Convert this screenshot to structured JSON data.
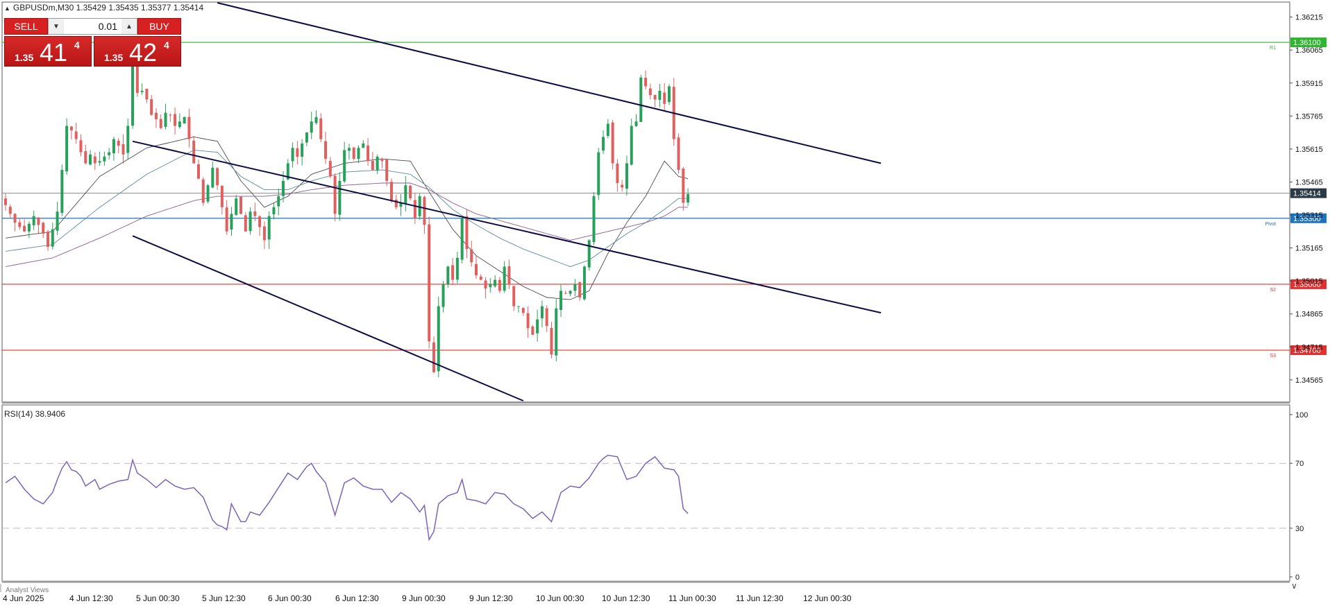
{
  "symbol_info": "GBPUSDm,M30  1.35429 1.35435 1.35377 1.35414",
  "trade_panel": {
    "sell_label": "SELL",
    "buy_label": "BUY",
    "lot_value": "0.01",
    "sell_price_small": "1.35",
    "sell_price_big": "41",
    "sell_price_sup": "4",
    "buy_price_small": "1.35",
    "buy_price_big": "42",
    "buy_price_sup": "4"
  },
  "chart_data": [
    {
      "type": "candlestick",
      "symbol": "GBPUSDm",
      "timeframe": "M30",
      "ohlc_current": {
        "open": 1.35429,
        "high": 1.35435,
        "low": 1.35377,
        "close": 1.35414
      },
      "current_price": 1.35414,
      "ylim": [
        1.3447,
        1.3628
      ],
      "y_ticks": [
        "1.36215",
        "1.36065",
        "1.35915",
        "1.35765",
        "1.35615",
        "1.35465",
        "1.35315",
        "1.35165",
        "1.35015",
        "1.34865",
        "1.34715",
        "1.34565"
      ],
      "x_ticks": [
        "4 Jun 2025",
        "4 Jun 12:30",
        "5 Jun 00:30",
        "5 Jun 12:30",
        "6 Jun 00:30",
        "6 Jun 12:30",
        "9 Jun 00:30",
        "9 Jun 12:30",
        "10 Jun 00:30",
        "10 Jun 12:30",
        "11 Jun 00:30",
        "11 Jun 12:30",
        "12 Jun 00:30"
      ],
      "horizontal_levels": [
        {
          "label": "R1",
          "price": 1.361,
          "price_label": "1.36100",
          "color": "#2fb52f"
        },
        {
          "label": "Pivot",
          "price": 1.353,
          "price_label": "1.35300",
          "color": "#1e73be"
        },
        {
          "label": "S2",
          "price": 1.35,
          "price_label": "1.35000",
          "color": "#e03030"
        },
        {
          "label": "S3",
          "price": 1.347,
          "price_label": "1.34700",
          "color": "#e03030"
        }
      ],
      "current_price_label": "1.35414",
      "close_path": [
        [
          0,
          1.3536
        ],
        [
          2,
          1.3528
        ],
        [
          4,
          1.3524
        ],
        [
          6,
          1.3531
        ],
        [
          8,
          1.3523
        ],
        [
          9,
          1.3517
        ],
        [
          11,
          1.3533
        ],
        [
          12,
          1.3552
        ],
        [
          13,
          1.3572
        ],
        [
          14,
          1.357
        ],
        [
          15,
          1.3566
        ],
        [
          16,
          1.356
        ],
        [
          17,
          1.3555
        ],
        [
          18,
          1.3559
        ],
        [
          19,
          1.3555
        ],
        [
          20,
          1.3556
        ],
        [
          21,
          1.3558
        ],
        [
          22,
          1.356
        ],
        [
          23,
          1.3566
        ],
        [
          24,
          1.3563
        ],
        [
          25,
          1.3559
        ],
        [
          26,
          1.3572
        ],
        [
          27,
          1.3605
        ],
        [
          28,
          1.3587
        ],
        [
          29,
          1.3588
        ],
        [
          30,
          1.3584
        ],
        [
          31,
          1.3577
        ],
        [
          32,
          1.3575
        ],
        [
          33,
          1.3571
        ],
        [
          34,
          1.3578
        ],
        [
          35,
          1.3577
        ],
        [
          36,
          1.3572
        ],
        [
          37,
          1.3574
        ],
        [
          38,
          1.3576
        ],
        [
          39,
          1.3566
        ],
        [
          40,
          1.3555
        ],
        [
          41,
          1.3548
        ],
        [
          42,
          1.3537
        ],
        [
          43,
          1.3545
        ],
        [
          44,
          1.3553
        ],
        [
          45,
          1.3545
        ],
        [
          46,
          1.3535
        ],
        [
          47,
          1.3524
        ],
        [
          48,
          1.3532
        ],
        [
          49,
          1.3539
        ],
        [
          50,
          1.3532
        ],
        [
          51,
          1.3524
        ],
        [
          52,
          1.3533
        ],
        [
          53,
          1.3531
        ],
        [
          54,
          1.3526
        ],
        [
          55,
          1.352
        ],
        [
          56,
          1.3531
        ],
        [
          57,
          1.3535
        ],
        [
          58,
          1.354
        ],
        [
          59,
          1.3547
        ],
        [
          60,
          1.3555
        ],
        [
          61,
          1.3562
        ],
        [
          62,
          1.3558
        ],
        [
          63,
          1.3564
        ],
        [
          64,
          1.3569
        ],
        [
          65,
          1.3574
        ],
        [
          66,
          1.3576
        ],
        [
          67,
          1.3566
        ],
        [
          68,
          1.3557
        ],
        [
          69,
          1.3549
        ],
        [
          70,
          1.3532
        ],
        [
          71,
          1.3547
        ],
        [
          72,
          1.3561
        ],
        [
          73,
          1.3562
        ],
        [
          74,
          1.3557
        ],
        [
          75,
          1.3562
        ],
        [
          76,
          1.3564
        ],
        [
          77,
          1.3556
        ],
        [
          78,
          1.3552
        ],
        [
          79,
          1.3558
        ],
        [
          80,
          1.3556
        ],
        [
          81,
          1.3547
        ],
        [
          82,
          1.3538
        ],
        [
          83,
          1.3535
        ],
        [
          84,
          1.3537
        ],
        [
          85,
          1.3545
        ],
        [
          86,
          1.3539
        ],
        [
          87,
          1.353
        ],
        [
          88,
          1.354
        ],
        [
          89,
          1.3527
        ],
        [
          90,
          1.3474
        ],
        [
          91,
          1.346
        ],
        [
          92,
          1.349
        ],
        [
          93,
          1.35
        ],
        [
          94,
          1.3508
        ],
        [
          95,
          1.3502
        ],
        [
          96,
          1.3512
        ],
        [
          97,
          1.353
        ],
        [
          98,
          1.3516
        ],
        [
          99,
          1.351
        ],
        [
          100,
          1.3504
        ],
        [
          101,
          1.3502
        ],
        [
          102,
          1.3498
        ],
        [
          103,
          1.35
        ],
        [
          104,
          1.3502
        ],
        [
          105,
          1.3497
        ],
        [
          106,
          1.3508
        ],
        [
          107,
          1.35
        ],
        [
          108,
          1.349
        ],
        [
          109,
          1.349
        ],
        [
          110,
          1.3487
        ],
        [
          111,
          1.348
        ],
        [
          112,
          1.3477
        ],
        [
          113,
          1.3484
        ],
        [
          114,
          1.349
        ],
        [
          115,
          1.3481
        ],
        [
          116,
          1.3468
        ],
        [
          117,
          1.3489
        ],
        [
          118,
          1.3497
        ],
        [
          119,
          1.3496
        ],
        [
          120,
          1.3497
        ],
        [
          121,
          1.35
        ],
        [
          122,
          1.3494
        ],
        [
          123,
          1.3508
        ],
        [
          124,
          1.352
        ],
        [
          125,
          1.354
        ],
        [
          126,
          1.356
        ],
        [
          127,
          1.3567
        ],
        [
          128,
          1.3573
        ],
        [
          129,
          1.3555
        ],
        [
          130,
          1.3546
        ],
        [
          131,
          1.3544
        ],
        [
          132,
          1.3555
        ],
        [
          133,
          1.3572
        ],
        [
          134,
          1.3574
        ],
        [
          135,
          1.3594
        ],
        [
          136,
          1.359
        ],
        [
          137,
          1.3586
        ],
        [
          138,
          1.3584
        ],
        [
          139,
          1.3588
        ],
        [
          140,
          1.3582
        ],
        [
          141,
          1.359
        ],
        [
          142,
          1.3566
        ],
        [
          143,
          1.3552
        ],
        [
          144,
          1.3537
        ],
        [
          145,
          1.3541
        ]
      ],
      "candle_count": 146,
      "moving_averages": {
        "ma_fast": [
          [
            0,
            1.3521
          ],
          [
            10,
            1.3524
          ],
          [
            20,
            1.3549
          ],
          [
            30,
            1.3562
          ],
          [
            40,
            1.3567
          ],
          [
            45,
            1.3565
          ],
          [
            50,
            1.3547
          ],
          [
            55,
            1.3535
          ],
          [
            60,
            1.354
          ],
          [
            65,
            1.355
          ],
          [
            72,
            1.3555
          ],
          [
            80,
            1.3557
          ],
          [
            86,
            1.3556
          ],
          [
            90,
            1.3542
          ],
          [
            95,
            1.3525
          ],
          [
            100,
            1.3513
          ],
          [
            105,
            1.3506
          ],
          [
            110,
            1.3499
          ],
          [
            115,
            1.3494
          ],
          [
            120,
            1.3493
          ],
          [
            124,
            1.3497
          ],
          [
            128,
            1.3514
          ],
          [
            132,
            1.3528
          ],
          [
            136,
            1.354
          ],
          [
            140,
            1.3556
          ],
          [
            143,
            1.3549
          ],
          [
            145,
            1.3548
          ]
        ],
        "ma_mid": [
          [
            0,
            1.3515
          ],
          [
            10,
            1.3518
          ],
          [
            20,
            1.3535
          ],
          [
            30,
            1.355
          ],
          [
            40,
            1.3561
          ],
          [
            45,
            1.356
          ],
          [
            50,
            1.3549
          ],
          [
            55,
            1.3543
          ],
          [
            60,
            1.3543
          ],
          [
            65,
            1.3547
          ],
          [
            72,
            1.3551
          ],
          [
            80,
            1.3552
          ],
          [
            86,
            1.355
          ],
          [
            90,
            1.3544
          ],
          [
            95,
            1.3534
          ],
          [
            100,
            1.3527
          ],
          [
            105,
            1.3521
          ],
          [
            110,
            1.3516
          ],
          [
            115,
            1.3512
          ],
          [
            120,
            1.3508
          ],
          [
            124,
            1.3511
          ],
          [
            128,
            1.3517
          ],
          [
            132,
            1.3523
          ],
          [
            136,
            1.3528
          ],
          [
            140,
            1.3534
          ],
          [
            143,
            1.3539
          ],
          [
            145,
            1.3539
          ]
        ],
        "ma_slow": [
          [
            0,
            1.3508
          ],
          [
            10,
            1.3512
          ],
          [
            20,
            1.3521
          ],
          [
            30,
            1.3531
          ],
          [
            40,
            1.3538
          ],
          [
            45,
            1.354
          ],
          [
            50,
            1.354
          ],
          [
            55,
            1.354
          ],
          [
            60,
            1.3541
          ],
          [
            65,
            1.3543
          ],
          [
            72,
            1.3545
          ],
          [
            80,
            1.3546
          ],
          [
            86,
            1.3546
          ],
          [
            90,
            1.3543
          ],
          [
            95,
            1.3537
          ],
          [
            100,
            1.3532
          ],
          [
            105,
            1.3529
          ],
          [
            110,
            1.3526
          ],
          [
            115,
            1.3523
          ],
          [
            120,
            1.352
          ],
          [
            124,
            1.3522
          ],
          [
            128,
            1.3524
          ],
          [
            132,
            1.3526
          ],
          [
            136,
            1.3528
          ],
          [
            140,
            1.3531
          ],
          [
            143,
            1.3535
          ],
          [
            145,
            1.3535
          ]
        ]
      },
      "trend_lines": [
        {
          "name": "channel-top",
          "points": [
            [
              45,
              1.3628
            ],
            [
              186,
              1.3555
            ]
          ]
        },
        {
          "name": "channel-mid",
          "points": [
            [
              27,
              1.3565
            ],
            [
              186,
              1.3487
            ]
          ]
        },
        {
          "name": "channel-bottom",
          "points": [
            [
              27,
              1.3522
            ],
            [
              110,
              1.3447
            ]
          ]
        }
      ]
    },
    {
      "type": "line",
      "indicator": "RSI",
      "label": "RSI(14) 38.9406",
      "value": 38.9406,
      "ylim": [
        0,
        100
      ],
      "y_ticks": [
        "100",
        "70",
        "30",
        "0"
      ],
      "levels": [
        70,
        30
      ],
      "color": "#7a63b8",
      "values": [
        [
          0,
          58
        ],
        [
          2,
          62
        ],
        [
          4,
          54
        ],
        [
          6,
          48
        ],
        [
          8,
          45
        ],
        [
          10,
          52
        ],
        [
          11,
          60
        ],
        [
          12,
          67
        ],
        [
          13,
          71
        ],
        [
          14,
          66
        ],
        [
          15,
          65
        ],
        [
          16,
          62
        ],
        [
          17,
          56
        ],
        [
          18,
          58
        ],
        [
          19,
          60
        ],
        [
          20,
          54
        ],
        [
          22,
          57
        ],
        [
          24,
          59
        ],
        [
          26,
          60
        ],
        [
          27,
          72
        ],
        [
          28,
          64
        ],
        [
          30,
          60
        ],
        [
          32,
          55
        ],
        [
          34,
          60
        ],
        [
          36,
          56
        ],
        [
          38,
          54
        ],
        [
          40,
          55
        ],
        [
          42,
          49
        ],
        [
          44,
          35
        ],
        [
          45,
          32
        ],
        [
          46,
          31
        ],
        [
          47,
          29
        ],
        [
          48,
          45
        ],
        [
          50,
          34
        ],
        [
          51,
          34
        ],
        [
          52,
          40
        ],
        [
          54,
          38
        ],
        [
          56,
          46
        ],
        [
          58,
          55
        ],
        [
          60,
          64
        ],
        [
          62,
          60
        ],
        [
          64,
          68
        ],
        [
          65,
          70
        ],
        [
          66,
          65
        ],
        [
          68,
          58
        ],
        [
          70,
          38
        ],
        [
          72,
          58
        ],
        [
          74,
          61
        ],
        [
          76,
          56
        ],
        [
          78,
          54
        ],
        [
          80,
          54
        ],
        [
          82,
          46
        ],
        [
          84,
          52
        ],
        [
          86,
          48
        ],
        [
          88,
          40
        ],
        [
          89,
          44
        ],
        [
          90,
          23
        ],
        [
          91,
          28
        ],
        [
          92,
          45
        ],
        [
          94,
          50
        ],
        [
          96,
          52
        ],
        [
          97,
          60
        ],
        [
          98,
          48
        ],
        [
          100,
          47
        ],
        [
          102,
          45
        ],
        [
          104,
          52
        ],
        [
          106,
          51
        ],
        [
          108,
          45
        ],
        [
          110,
          42
        ],
        [
          112,
          36
        ],
        [
          114,
          40
        ],
        [
          116,
          34
        ],
        [
          118,
          52
        ],
        [
          120,
          56
        ],
        [
          122,
          55
        ],
        [
          124,
          61
        ],
        [
          126,
          70
        ],
        [
          127,
          73
        ],
        [
          128,
          75
        ],
        [
          130,
          74
        ],
        [
          132,
          60
        ],
        [
          134,
          62
        ],
        [
          136,
          70
        ],
        [
          137,
          72
        ],
        [
          138,
          74
        ],
        [
          140,
          67
        ],
        [
          142,
          66
        ],
        [
          143,
          62
        ],
        [
          144,
          42
        ],
        [
          145,
          39
        ]
      ]
    }
  ],
  "bottom_bar": {
    "analyst_label": "Analyst Views"
  }
}
